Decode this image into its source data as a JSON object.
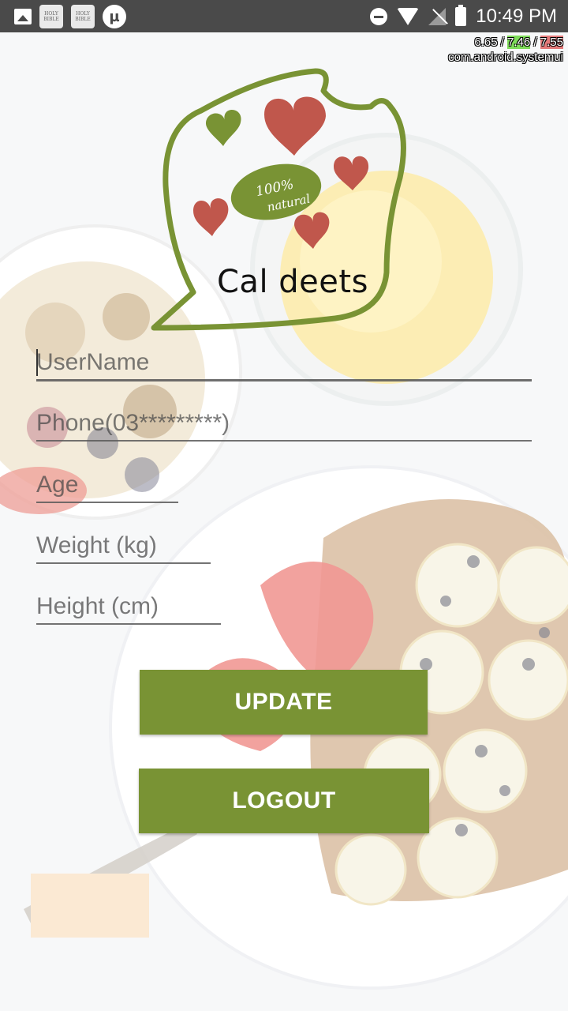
{
  "status_bar": {
    "time": "10:49 PM",
    "left_icons": [
      "gallery-icon",
      "bible-app-icon",
      "bible-app-icon",
      "utorrent-icon"
    ],
    "right_icons": [
      "do-not-disturb-icon",
      "wifi-icon",
      "no-signal-icon",
      "battery-icon"
    ],
    "bible_icon_text": "HOLY BIBLE"
  },
  "debug_overlay": {
    "v1": "6.65",
    "v2": "7.46",
    "v3": "7.55",
    "process": "com.android.systemui"
  },
  "logo": {
    "badge_line1": "100%",
    "badge_line2": "natural",
    "title": "Cal deets"
  },
  "form": {
    "username": {
      "value": "",
      "placeholder": "UserName"
    },
    "phone": {
      "value": "",
      "placeholder": "Phone(03*********)"
    },
    "age": {
      "value": "",
      "placeholder": "Age"
    },
    "weight": {
      "value": "",
      "placeholder": "Weight (kg)"
    },
    "height": {
      "value": "",
      "placeholder": "Height (cm)"
    }
  },
  "buttons": {
    "update": "UPDATE",
    "logout": "LOGOUT"
  },
  "colors": {
    "accent_green": "#799334",
    "heart_red": "#c0574c",
    "status_bar": "#4a4a4a"
  }
}
